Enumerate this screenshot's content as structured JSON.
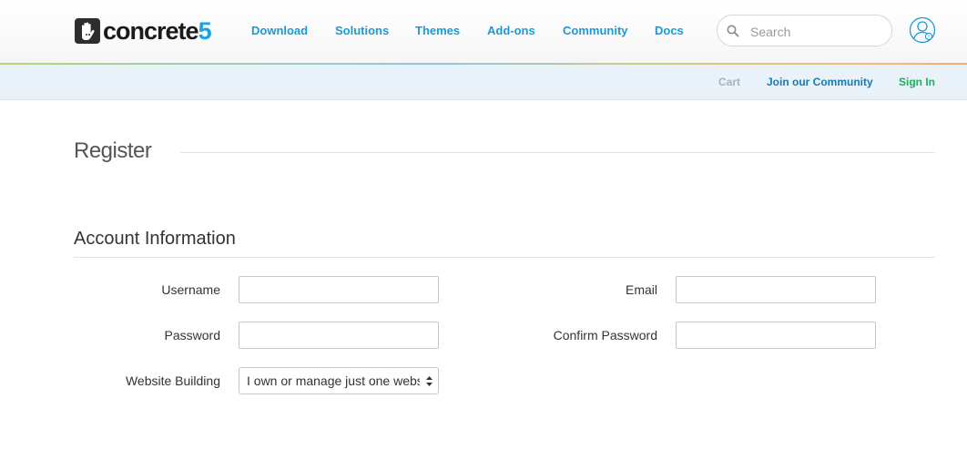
{
  "header": {
    "logo_text": "concrete",
    "logo_suffix": "5",
    "nav": [
      "Download",
      "Solutions",
      "Themes",
      "Add-ons",
      "Community",
      "Docs"
    ],
    "search_placeholder": "Search",
    "icons": {
      "search": "search-icon",
      "account": "user-account-icon",
      "logo": "hand-logo-icon"
    }
  },
  "subnav": {
    "cart": "Cart",
    "join": "Join our Community",
    "signin": "Sign In"
  },
  "page": {
    "title": "Register",
    "section_title": "Account Information"
  },
  "form": {
    "username_label": "Username",
    "email_label": "Email",
    "password_label": "Password",
    "confirm_label": "Confirm Password",
    "website_label": "Website Building",
    "website_value": "I own or manage just one website"
  },
  "colors": {
    "link_blue": "#1a9ad6",
    "join_blue": "#1679b8",
    "signin_green": "#19b35e",
    "cart_gray": "#a8b3bd",
    "brand_five": "#1aa3dd"
  }
}
